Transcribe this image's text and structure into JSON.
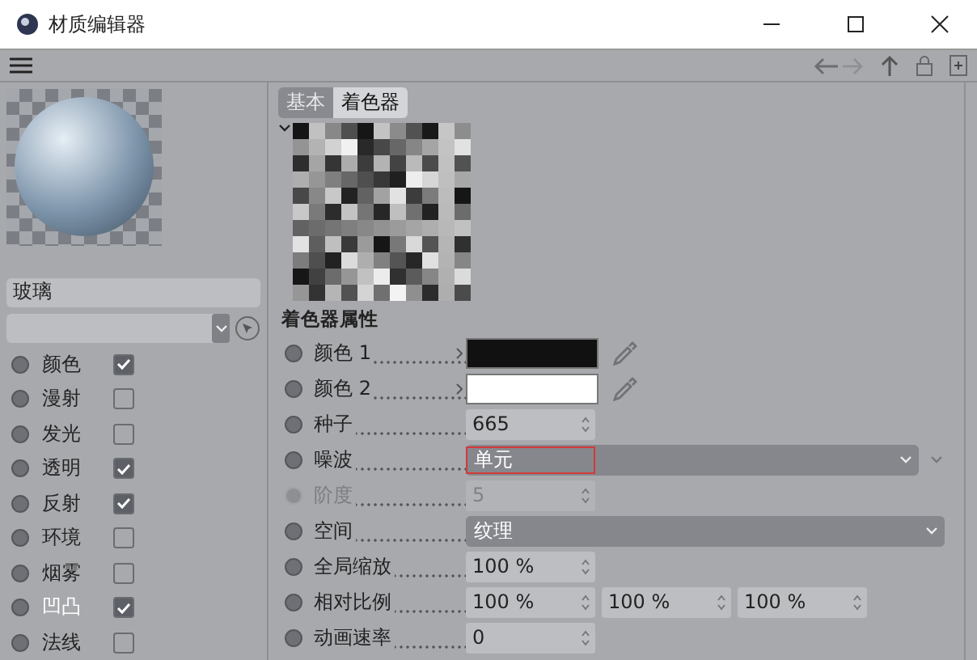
{
  "window": {
    "title": "材质编辑器"
  },
  "material": {
    "name": "玻璃"
  },
  "channels": [
    {
      "label": "颜色",
      "checked": true,
      "selected": false
    },
    {
      "label": "漫射",
      "checked": false,
      "selected": false
    },
    {
      "label": "发光",
      "checked": false,
      "selected": false
    },
    {
      "label": "透明",
      "checked": true,
      "selected": false
    },
    {
      "label": "反射",
      "checked": true,
      "selected": false
    },
    {
      "label": "环境",
      "checked": false,
      "selected": false
    },
    {
      "label": "烟雾",
      "checked": false,
      "selected": false
    },
    {
      "label": "凹凸",
      "checked": true,
      "selected": true
    },
    {
      "label": "法线",
      "checked": false,
      "selected": false
    }
  ],
  "tabs": [
    {
      "label": "基本",
      "selected": false
    },
    {
      "label": "着色器",
      "selected": true
    }
  ],
  "section": {
    "title": "着色器属性"
  },
  "properties": [
    {
      "kind": "color",
      "label": "颜色 1",
      "color": "#111111",
      "disabled": false
    },
    {
      "kind": "color",
      "label": "颜色 2",
      "color": "#ffffff",
      "disabled": false
    },
    {
      "kind": "number",
      "label": "种子",
      "value": "665",
      "disabled": false
    },
    {
      "kind": "dropdown",
      "label": "噪波",
      "value": "单元",
      "highlighted": true,
      "expander": true,
      "disabled": false
    },
    {
      "kind": "number",
      "label": "阶度",
      "value": "5",
      "disabled": true
    },
    {
      "kind": "dropdown",
      "label": "空间",
      "value": "纹理",
      "highlighted": false,
      "expander": false,
      "disabled": false
    },
    {
      "kind": "number",
      "label": "全局缩放",
      "value": "100 %",
      "disabled": false
    },
    {
      "kind": "vector",
      "label": "相对比例",
      "values": [
        "100 %",
        "100 %",
        "100 %"
      ],
      "disabled": false
    },
    {
      "kind": "number",
      "label": "动画速率",
      "value": "0",
      "disabled": false
    }
  ]
}
